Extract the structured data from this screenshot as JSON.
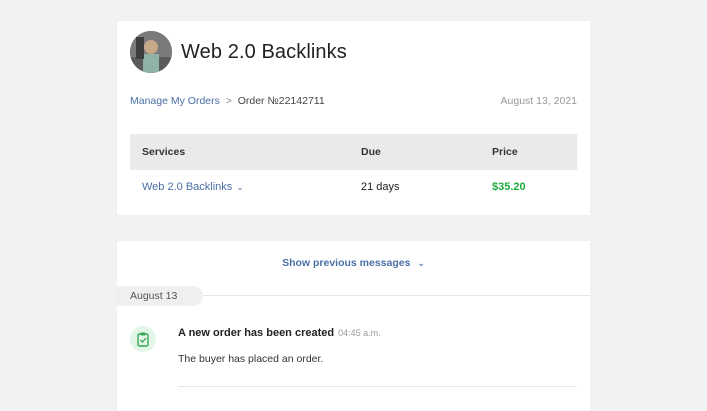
{
  "order": {
    "service_title": "Web 2.0 Backlinks",
    "breadcrumb": {
      "manage_orders": "Manage My Orders",
      "separator": ">",
      "order_number": "Order №22142711"
    },
    "date": "August 13, 2021"
  },
  "table": {
    "headers": {
      "services": "Services",
      "due": "Due",
      "price": "Price"
    },
    "row": {
      "service": "Web 2.0 Backlinks",
      "due": "21 days",
      "price": "$35.20"
    }
  },
  "messages": {
    "show_previous": "Show previous messages",
    "date_group": "August 13",
    "event": {
      "title": "A new order has been created",
      "time": "04:45 a.m.",
      "text": "The buyer has placed an order."
    }
  },
  "colors": {
    "link": "#4a6fa5",
    "price": "#1faa3c",
    "icon_bg": "#e3f5e6"
  }
}
